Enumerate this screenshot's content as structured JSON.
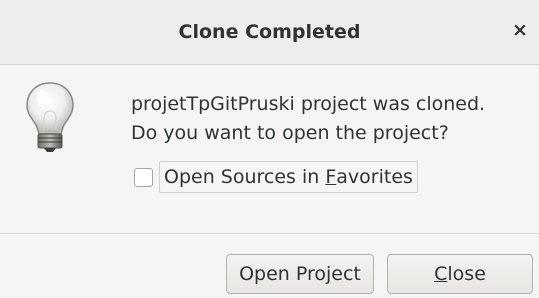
{
  "window": {
    "title": "Clone Completed",
    "close_glyph": "×"
  },
  "message": {
    "line1": "projetTpGitPruski project was cloned.",
    "line2": "Do you want to open the project?"
  },
  "checkbox": {
    "label_prefix": "Open Sources in ",
    "label_mnemonic": "F",
    "label_suffix": "avorites",
    "checked": false
  },
  "buttons": {
    "open_label": "Open Project",
    "close_mnemonic": "C",
    "close_suffix": "lose"
  },
  "icons": {
    "dialog_icon": "lightbulb-icon"
  }
}
